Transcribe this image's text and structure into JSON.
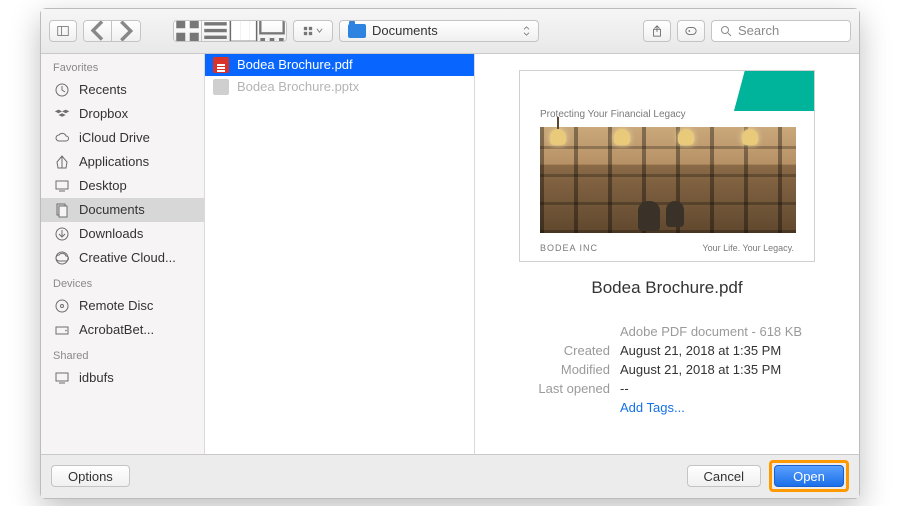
{
  "toolbar": {
    "path_label": "Documents"
  },
  "search": {
    "placeholder": "Search"
  },
  "sidebar": {
    "sections": [
      {
        "header": "Favorites",
        "items": [
          {
            "icon": "clock-icon",
            "label": "Recents"
          },
          {
            "icon": "dropbox-icon",
            "label": "Dropbox"
          },
          {
            "icon": "cloud-icon",
            "label": "iCloud Drive"
          },
          {
            "icon": "apps-icon",
            "label": "Applications"
          },
          {
            "icon": "desktop-icon",
            "label": "Desktop"
          },
          {
            "icon": "documents-icon",
            "label": "Documents",
            "active": true
          },
          {
            "icon": "downloads-icon",
            "label": "Downloads"
          },
          {
            "icon": "creative-cloud-icon",
            "label": "Creative Cloud..."
          }
        ]
      },
      {
        "header": "Devices",
        "items": [
          {
            "icon": "disc-icon",
            "label": "Remote Disc"
          },
          {
            "icon": "drive-icon",
            "label": "AcrobatBet...",
            "eject": true
          }
        ]
      },
      {
        "header": "Shared",
        "items": [
          {
            "icon": "server-icon",
            "label": "idbufs"
          }
        ]
      }
    ]
  },
  "files": [
    {
      "icon": "pdf-icon",
      "name": "Bodea Brochure.pdf",
      "selected": true
    },
    {
      "icon": "ppt-icon",
      "name": "Bodea Brochure.pptx",
      "dim": true
    }
  ],
  "preview": {
    "thumb_title": "Protecting Your Financial Legacy",
    "thumb_footer_left": "BODEA INC",
    "thumb_footer_right": "Your Life. Your Legacy.",
    "name": "Bodea Brochure.pdf",
    "doc_type": "Adobe PDF document - 618 KB",
    "meta": {
      "created_label": "Created",
      "created_val": "August 21, 2018 at 1:35 PM",
      "modified_label": "Modified",
      "modified_val": "August 21, 2018 at 1:35 PM",
      "lastopened_label": "Last opened",
      "lastopened_val": "--",
      "addtags": "Add Tags..."
    }
  },
  "buttons": {
    "options": "Options",
    "cancel": "Cancel",
    "open": "Open"
  }
}
